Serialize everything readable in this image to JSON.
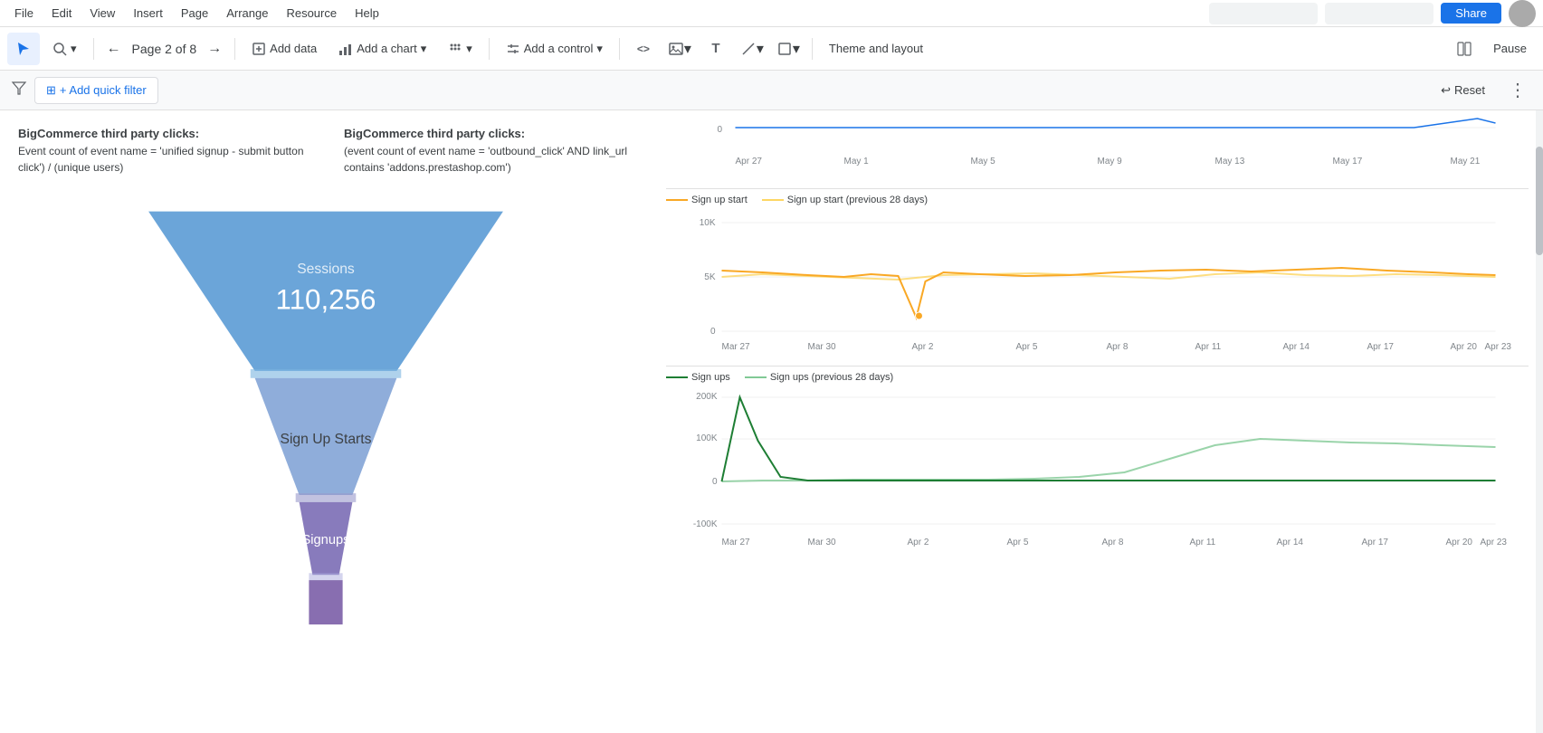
{
  "menu": {
    "items": [
      "File",
      "Edit",
      "View",
      "Insert",
      "Page",
      "Arrange",
      "Resource",
      "Help"
    ]
  },
  "toolbar": {
    "select_tool_label": "▲",
    "zoom_label": "⊕",
    "prev_page_label": "←",
    "page_info": "Page 2 of 8",
    "next_page_label": "→",
    "add_data_label": "Add data",
    "add_chart_label": "Add a chart",
    "add_control_label": "Add a control",
    "code_label": "<>",
    "image_label": "🖼",
    "text_label": "T",
    "shape_label": "/",
    "rect_label": "□",
    "theme_label": "Theme and layout",
    "pause_label": "Pause"
  },
  "filter_bar": {
    "add_filter_label": "+ Add quick filter",
    "reset_label": "↩ Reset"
  },
  "left_panel": {
    "bc_label1_title": "BigCommerce third party clicks:",
    "bc_label1_body": "Event count of event name = 'unified signup - submit button click') / (unique users)",
    "bc_label2_title": "BigCommerce third party clicks:",
    "bc_label2_body": "(event count of event name = 'outbound_click' AND link_url contains 'addons.prestashop.com')",
    "funnel": {
      "sessions_label": "Sessions",
      "sessions_value": "110,256",
      "sign_up_starts_label": "Sign Up Starts",
      "signups_label": "Signups"
    }
  },
  "right_panel": {
    "top_chart": {
      "y_max": "0",
      "x_labels": [
        "Apr 27",
        "May 1",
        "May 5",
        "May 9",
        "May 13",
        "May 17",
        "May 21"
      ]
    },
    "sign_up_chart": {
      "legend1": "Sign up start",
      "legend2": "Sign up start (previous 28 days)",
      "y_labels": [
        "10K",
        "5K",
        "0"
      ],
      "x_labels": [
        "Mar 27",
        "Mar 30",
        "Apr 2",
        "Apr 5",
        "Apr 8",
        "Apr 11",
        "Apr 14",
        "Apr 17",
        "Apr 20",
        "Apr 23"
      ]
    },
    "signups_chart": {
      "legend1": "Sign ups",
      "legend2": "Sign ups (previous 28 days)",
      "y_labels": [
        "200K",
        "100K",
        "0",
        "-100K"
      ],
      "x_labels": [
        "Mar 27",
        "Mar 30",
        "Apr 2",
        "Apr 5",
        "Apr 8",
        "Apr 11",
        "Apr 14",
        "Apr 17",
        "Apr 20",
        "Apr 23"
      ]
    }
  }
}
